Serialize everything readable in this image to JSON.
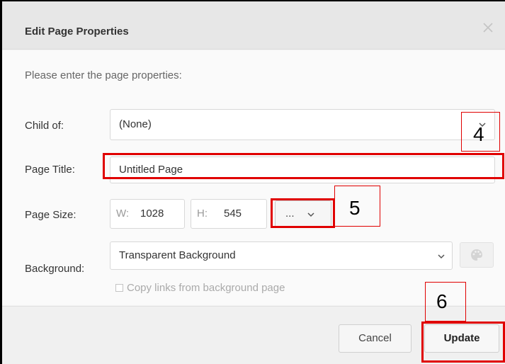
{
  "dialog": {
    "title": "Edit Page Properties",
    "close_icon": "close-icon",
    "intro": "Please enter the page properties:"
  },
  "form": {
    "child_of": {
      "label": "Child of:",
      "value": "(None)"
    },
    "page_title": {
      "label": "Page Title:",
      "value": "Untitled Page"
    },
    "page_size": {
      "label": "Page Size:",
      "width_prefix": "W:",
      "width_value": "1028",
      "height_prefix": "H:",
      "height_value": "545",
      "preset_label": "..."
    },
    "background": {
      "label": "Background:",
      "value": "Transparent Background",
      "palette_icon": "palette-icon",
      "copy_links_label": "Copy links from background page"
    }
  },
  "footer": {
    "cancel_label": "Cancel",
    "update_label": "Update"
  },
  "annotations": {
    "a4": "4",
    "a5": "5",
    "a6": "6",
    "color": "#e00000"
  }
}
